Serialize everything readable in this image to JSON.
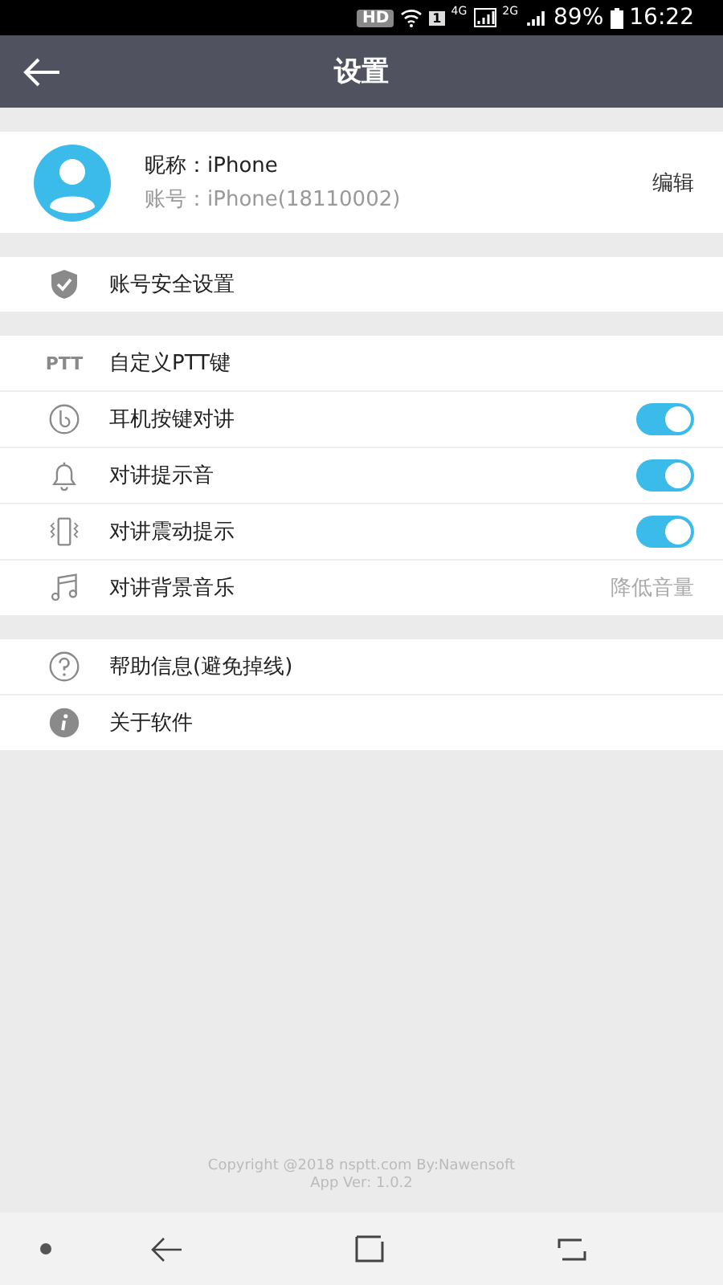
{
  "status_bar": {
    "hd": "HD",
    "sim": "1",
    "network": "4G",
    "network_2": "2G",
    "battery": "89%",
    "time": "16:22"
  },
  "header": {
    "title": "设置"
  },
  "profile": {
    "nickname": "昵称：iPhone",
    "account": "账号：iPhone(18110002)",
    "action": "编辑"
  },
  "sections": [
    {
      "rows": [
        {
          "kind": "plain",
          "label": "账号安全设置"
        }
      ]
    },
    {
      "rows": [
        {
          "kind": "plain",
          "label": "自定义PTT键",
          "icon_text": "PTT"
        },
        {
          "kind": "toggle",
          "label": "耳机按键对讲",
          "on": true
        },
        {
          "kind": "toggle",
          "label": "对讲提示音",
          "on": true
        },
        {
          "kind": "toggle",
          "label": "对讲震动提示",
          "on": true
        },
        {
          "kind": "value",
          "label": "对讲背景音乐",
          "value": "降低音量"
        }
      ]
    },
    {
      "rows": [
        {
          "kind": "plain",
          "label": "帮助信息(避免掉线)"
        },
        {
          "kind": "plain",
          "label": "关于软件"
        }
      ]
    }
  ],
  "footer": {
    "lines": [
      "Copyright @2018 nsptt.com By:Nawensoft",
      "App Ver: 1.0.2"
    ]
  }
}
